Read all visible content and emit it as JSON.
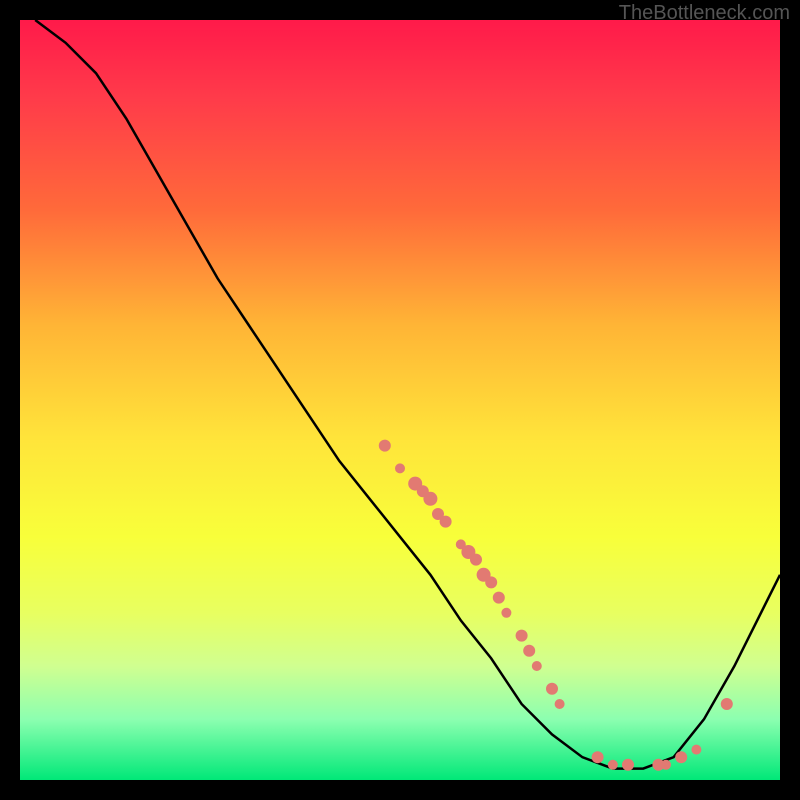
{
  "watermark": "TheBottleneck.com",
  "chart_data": {
    "type": "line",
    "title": "",
    "xlabel": "",
    "ylabel": "",
    "xlim": [
      0,
      100
    ],
    "ylim": [
      0,
      100
    ],
    "curve_points": [
      {
        "x": 2,
        "y": 100
      },
      {
        "x": 6,
        "y": 97
      },
      {
        "x": 10,
        "y": 93
      },
      {
        "x": 14,
        "y": 87
      },
      {
        "x": 18,
        "y": 80
      },
      {
        "x": 22,
        "y": 73
      },
      {
        "x": 26,
        "y": 66
      },
      {
        "x": 30,
        "y": 60
      },
      {
        "x": 34,
        "y": 54
      },
      {
        "x": 38,
        "y": 48
      },
      {
        "x": 42,
        "y": 42
      },
      {
        "x": 46,
        "y": 37
      },
      {
        "x": 50,
        "y": 32
      },
      {
        "x": 54,
        "y": 27
      },
      {
        "x": 58,
        "y": 21
      },
      {
        "x": 62,
        "y": 16
      },
      {
        "x": 66,
        "y": 10
      },
      {
        "x": 70,
        "y": 6
      },
      {
        "x": 74,
        "y": 3
      },
      {
        "x": 78,
        "y": 1.5
      },
      {
        "x": 82,
        "y": 1.5
      },
      {
        "x": 86,
        "y": 3
      },
      {
        "x": 90,
        "y": 8
      },
      {
        "x": 94,
        "y": 15
      },
      {
        "x": 98,
        "y": 23
      },
      {
        "x": 100,
        "y": 27
      }
    ],
    "series": [
      {
        "name": "points",
        "color": "#e27a72",
        "values": [
          {
            "x": 48,
            "y": 44,
            "r": 6
          },
          {
            "x": 50,
            "y": 41,
            "r": 5
          },
          {
            "x": 52,
            "y": 39,
            "r": 7
          },
          {
            "x": 53,
            "y": 38,
            "r": 6
          },
          {
            "x": 54,
            "y": 37,
            "r": 7
          },
          {
            "x": 55,
            "y": 35,
            "r": 6
          },
          {
            "x": 56,
            "y": 34,
            "r": 6
          },
          {
            "x": 58,
            "y": 31,
            "r": 5
          },
          {
            "x": 59,
            "y": 30,
            "r": 7
          },
          {
            "x": 60,
            "y": 29,
            "r": 6
          },
          {
            "x": 61,
            "y": 27,
            "r": 7
          },
          {
            "x": 62,
            "y": 26,
            "r": 6
          },
          {
            "x": 63,
            "y": 24,
            "r": 6
          },
          {
            "x": 64,
            "y": 22,
            "r": 5
          },
          {
            "x": 66,
            "y": 19,
            "r": 6
          },
          {
            "x": 67,
            "y": 17,
            "r": 6
          },
          {
            "x": 68,
            "y": 15,
            "r": 5
          },
          {
            "x": 70,
            "y": 12,
            "r": 6
          },
          {
            "x": 71,
            "y": 10,
            "r": 5
          },
          {
            "x": 76,
            "y": 3,
            "r": 6
          },
          {
            "x": 78,
            "y": 2,
            "r": 5
          },
          {
            "x": 80,
            "y": 2,
            "r": 6
          },
          {
            "x": 84,
            "y": 2,
            "r": 6
          },
          {
            "x": 85,
            "y": 2,
            "r": 5
          },
          {
            "x": 87,
            "y": 3,
            "r": 6
          },
          {
            "x": 89,
            "y": 4,
            "r": 5
          },
          {
            "x": 93,
            "y": 10,
            "r": 6
          }
        ]
      }
    ]
  }
}
